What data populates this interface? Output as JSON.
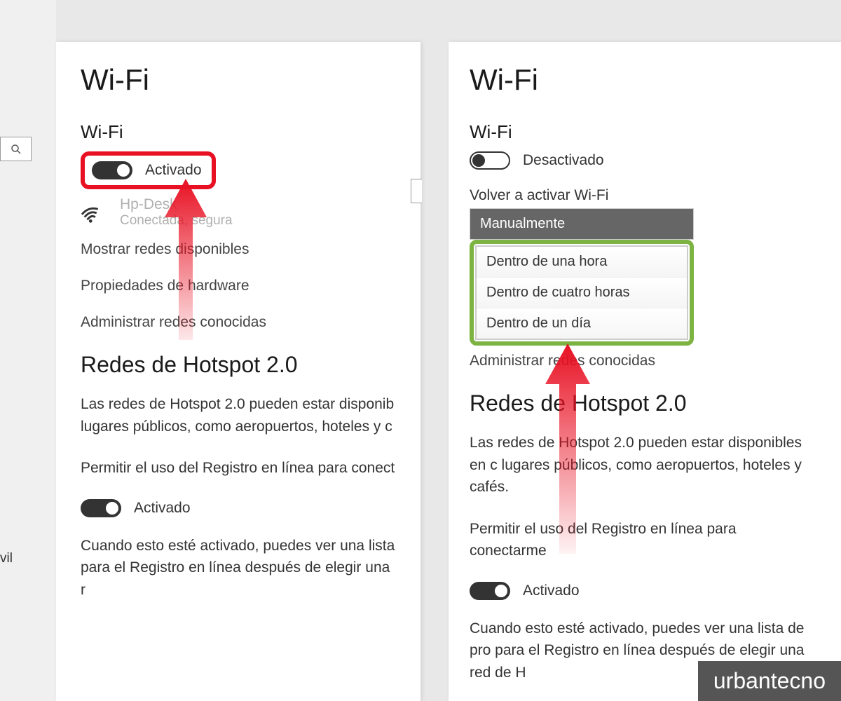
{
  "left": {
    "page_title": "Wi-Fi",
    "section_title": "Wi-Fi",
    "toggle_state": "Activado",
    "network_name": "Hp-Desk",
    "network_status": "Conectada, segura",
    "link_show_networks": "Mostrar redes disponibles",
    "link_hardware": "Propiedades de hardware",
    "link_known": "Administrar redes conocidas",
    "hotspot_title": "Redes de Hotspot 2.0",
    "hotspot_desc": "Las redes de Hotspot 2.0 pueden estar disponib lugares públicos, como aeropuertos, hoteles y c",
    "registry_label": "Permitir el uso del Registro en línea para conect",
    "registry_toggle": "Activado",
    "registry_desc": "Cuando esto esté activado, puedes ver una lista para el Registro en línea después de elegir una r"
  },
  "right": {
    "page_title": "Wi-Fi",
    "section_title": "Wi-Fi",
    "toggle_state": "Desactivado",
    "reactivate_label": "Volver a activar Wi-Fi",
    "dropdown_selected": "Manualmente",
    "dropdown_options": [
      "Dentro de una hora",
      "Dentro de cuatro horas",
      "Dentro de un día"
    ],
    "link_known": "Administrar redes conocidas",
    "hotspot_title": "Redes de Hotspot 2.0",
    "hotspot_desc": "Las redes de Hotspot 2.0 pueden estar disponibles en c lugares públicos, como aeropuertos, hoteles y cafés.",
    "registry_label": "Permitir el uso del Registro en línea para conectarme",
    "registry_toggle": "Activado",
    "registry_desc": "Cuando esto esté activado, puedes ver una lista de pro para el Registro en línea después de elegir una red de H"
  },
  "sidebar": {
    "vil": "vil"
  },
  "watermark": "urbantecno"
}
